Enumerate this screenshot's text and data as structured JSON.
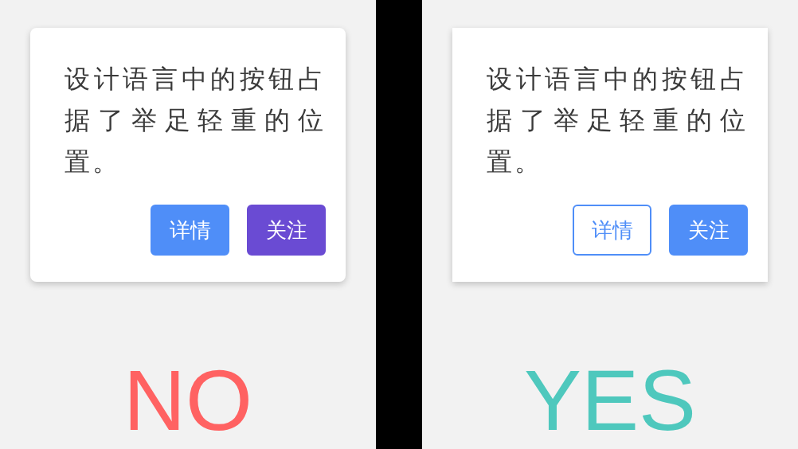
{
  "panels": [
    {
      "card": {
        "kind": "rounded",
        "text": "设计语言中的按钮占据了举足轻重的位置。",
        "buttons": [
          {
            "label": "详情",
            "kind": "primary"
          },
          {
            "label": "关注",
            "kind": "purple"
          }
        ]
      },
      "verdict": {
        "text": "NO",
        "color": "#ff6262"
      }
    },
    {
      "card": {
        "kind": "square",
        "text": "设计语言中的按钮占据了举足轻重的位置。",
        "buttons": [
          {
            "label": "详情",
            "kind": "outline"
          },
          {
            "label": "关注",
            "kind": "primary"
          }
        ]
      },
      "verdict": {
        "text": "YES",
        "color": "#4ec8bd"
      }
    }
  ]
}
